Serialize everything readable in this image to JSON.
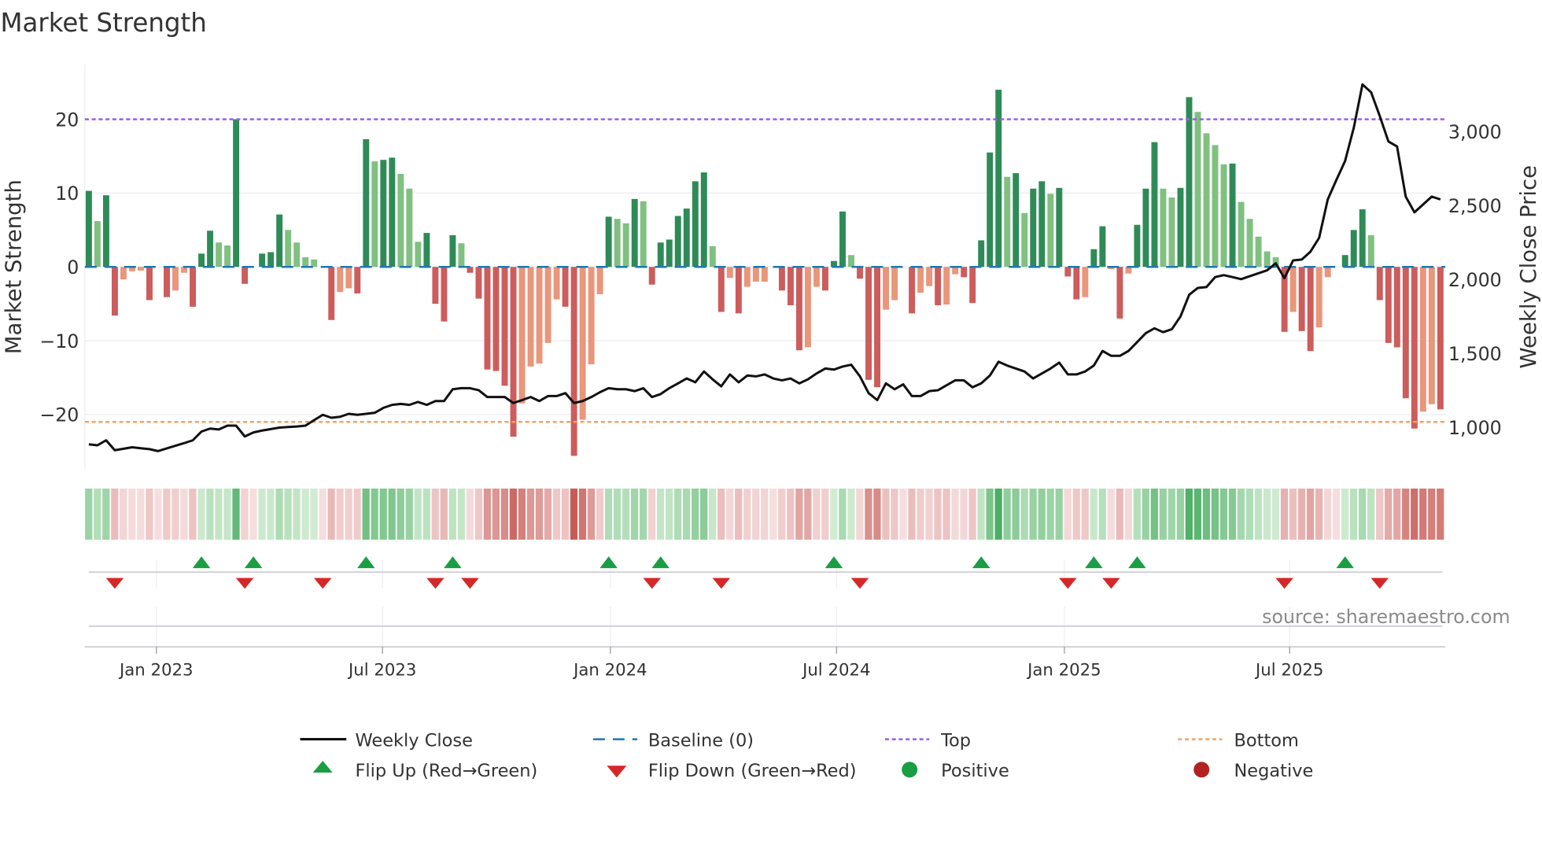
{
  "title": "Market Strength",
  "source": "source: sharemaestro.com",
  "colors": {
    "strong_positive": "#2e8b57",
    "weak_positive": "#80c080",
    "strong_negative": "#cd5c5c",
    "weak_negative": "#e9967a",
    "price_line": "#111111",
    "baseline": "#1f77b4",
    "top": "#9b5de5",
    "bottom": "#f4a261",
    "flip_up": "#1a9e44",
    "flip_down": "#d62728",
    "positive_dot": "#1a9e44",
    "negative_dot": "#b22222"
  },
  "legend": {
    "weekly_close": "Weekly Close",
    "baseline": "Baseline (0)",
    "top": "Top",
    "bottom": "Bottom",
    "flip_up": "Flip Up (Red→Green)",
    "flip_down": "Flip Down (Green→Red)",
    "positive": "Positive",
    "negative": "Negative"
  },
  "chart_data": {
    "type": "bar",
    "title": "Market Strength",
    "ylabel": "Market Strength",
    "y2label": "Weekly Close Price",
    "ylim": [
      -27.5,
      27.5
    ],
    "y2lim": [
      714,
      3458
    ],
    "yticks": [
      {
        "v": 20,
        "label": "20"
      },
      {
        "v": 10,
        "label": "10"
      },
      {
        "v": 0,
        "label": "0"
      },
      {
        "v": -10,
        "label": "−10"
      },
      {
        "v": -20,
        "label": "−20"
      }
    ],
    "y2ticks": [
      {
        "v": 3000,
        "label": "3,000"
      },
      {
        "v": 2500,
        "label": "2,500"
      },
      {
        "v": 2000,
        "label": "2,000"
      },
      {
        "v": 1500,
        "label": "1,500"
      },
      {
        "v": 1000,
        "label": "1,000"
      }
    ],
    "xticks": [
      {
        "week": 7.8,
        "label": "Jan 2023"
      },
      {
        "week": 33.9,
        "label": "Jul 2023"
      },
      {
        "week": 60.2,
        "label": "Jan 2024"
      },
      {
        "week": 86.3,
        "label": "Jul 2024"
      },
      {
        "week": 112.6,
        "label": "Jan 2025"
      },
      {
        "week": 138.6,
        "label": "Jul 2025"
      }
    ],
    "top_level": 20,
    "bottom_level": -21,
    "baseline": 0,
    "strength": [
      10.3,
      6.2,
      9.7,
      -6.6,
      -1.7,
      -0.6,
      -0.5,
      -4.5,
      0,
      -4.1,
      -3.2,
      -0.8,
      -5.4,
      1.8,
      4.9,
      3.3,
      2.9,
      20,
      -2.3,
      0,
      1.8,
      2,
      7.1,
      5,
      3.3,
      1.3,
      1,
      0,
      -7.2,
      -3.4,
      -2.9,
      -3.6,
      17.3,
      14.3,
      14.5,
      14.8,
      12.6,
      10.6,
      3.4,
      4.6,
      -5,
      -7.4,
      4.3,
      3.2,
      -0.8,
      -4.3,
      -13.9,
      -14.1,
      -16.1,
      -23,
      -18.5,
      -13.5,
      -13.1,
      -10.3,
      -4.4,
      -5.4,
      -25.6,
      -20.7,
      -13.2,
      -3.7,
      6.8,
      6.5,
      5.9,
      9.2,
      8.9,
      -2.4,
      3.3,
      3.7,
      6.9,
      7.9,
      11.6,
      12.8,
      2.8,
      -6.1,
      -1.5,
      -6.3,
      -2.7,
      -2,
      -2,
      0,
      -3.2,
      -5.2,
      -11.3,
      -10.9,
      -2.7,
      -3.2,
      0.8,
      7.5,
      1.6,
      -1.6,
      -15.3,
      -16.3,
      -5.8,
      -4.5,
      0,
      -6.3,
      -3.5,
      -2.6,
      -5.2,
      -5.1,
      -1,
      -1.4,
      -4.9,
      3.6,
      15.5,
      24,
      12.2,
      12.7,
      7.3,
      10.6,
      11.6,
      9.9,
      10.7,
      -1.3,
      -4.4,
      -4.1,
      2.4,
      5.5,
      -0.3,
      -7,
      -0.9,
      5.7,
      10.6,
      16.9,
      10.6,
      9.4,
      10.7,
      23,
      21,
      18.1,
      16.5,
      13.9,
      14,
      8.8,
      6.5,
      4.1,
      2.1,
      1.3,
      -8.8,
      -6.1,
      -8.7,
      -11.4,
      -8.2,
      -1.4,
      0,
      1.6,
      5,
      7.8,
      4.3,
      -4.5,
      -10.3,
      -10.9,
      -17.8,
      -21.9,
      -19.6,
      -18.6,
      -19.3
    ],
    "strong": [
      1,
      0,
      1,
      1,
      0,
      0,
      0,
      1,
      0,
      1,
      0,
      0,
      1,
      1,
      1,
      0,
      0,
      1,
      1,
      0,
      1,
      1,
      1,
      0,
      0,
      0,
      0,
      0,
      1,
      0,
      0,
      1,
      1,
      0,
      1,
      1,
      0,
      0,
      0,
      1,
      1,
      1,
      1,
      0,
      1,
      1,
      1,
      1,
      1,
      1,
      0,
      0,
      0,
      0,
      0,
      1,
      1,
      0,
      0,
      0,
      1,
      0,
      0,
      1,
      0,
      1,
      1,
      1,
      1,
      1,
      1,
      1,
      0,
      1,
      0,
      1,
      0,
      0,
      0,
      0,
      1,
      1,
      1,
      0,
      0,
      1,
      1,
      1,
      0,
      1,
      1,
      1,
      0,
      0,
      0,
      1,
      0,
      0,
      1,
      0,
      0,
      1,
      1,
      1,
      1,
      1,
      0,
      1,
      0,
      1,
      1,
      0,
      1,
      1,
      1,
      0,
      1,
      1,
      0,
      1,
      0,
      1,
      1,
      1,
      0,
      0,
      1,
      1,
      0,
      0,
      0,
      0,
      1,
      0,
      0,
      0,
      0,
      0,
      1,
      0,
      1,
      1,
      0,
      0,
      0,
      1,
      1,
      1,
      0,
      1,
      1,
      1,
      1,
      1,
      0,
      0,
      1
    ],
    "weekly_close": [
      887,
      880,
      914,
      847,
      857,
      867,
      860,
      854,
      841,
      859,
      877,
      895,
      914,
      973,
      993,
      987,
      1013,
      1013,
      940,
      967,
      980,
      990,
      1000,
      1004,
      1007,
      1013,
      1050,
      1086,
      1066,
      1073,
      1093,
      1086,
      1093,
      1100,
      1133,
      1153,
      1160,
      1153,
      1173,
      1153,
      1179,
      1179,
      1259,
      1266,
      1266,
      1253,
      1206,
      1206,
      1206,
      1166,
      1186,
      1206,
      1179,
      1213,
      1213,
      1233,
      1166,
      1179,
      1206,
      1239,
      1266,
      1259,
      1259,
      1246,
      1266,
      1206,
      1226,
      1266,
      1299,
      1332,
      1306,
      1379,
      1326,
      1279,
      1359,
      1306,
      1352,
      1346,
      1359,
      1332,
      1319,
      1332,
      1299,
      1326,
      1366,
      1399,
      1392,
      1412,
      1425,
      1346,
      1233,
      1186,
      1299,
      1259,
      1292,
      1213,
      1213,
      1246,
      1252,
      1286,
      1319,
      1319,
      1272,
      1299,
      1352,
      1445,
      1419,
      1399,
      1379,
      1332,
      1366,
      1399,
      1439,
      1359,
      1359,
      1379,
      1419,
      1518,
      1485,
      1485,
      1518,
      1578,
      1638,
      1671,
      1645,
      1665,
      1751,
      1897,
      1944,
      1950,
      2017,
      2030,
      2017,
      2003,
      2023,
      2043,
      2063,
      2110,
      2010,
      2130,
      2136,
      2189,
      2282,
      2542,
      2674,
      2801,
      3027,
      3319,
      3266,
      3106,
      2934,
      2900,
      2561,
      2455,
      2508,
      2561,
      2542
    ],
    "flip_up_weeks": [
      13,
      19,
      32,
      42,
      60,
      66,
      86,
      103,
      116,
      121,
      145
    ],
    "flip_down_weeks": [
      3,
      18,
      27,
      40,
      44,
      65,
      73,
      89,
      113,
      118,
      138,
      149
    ]
  }
}
